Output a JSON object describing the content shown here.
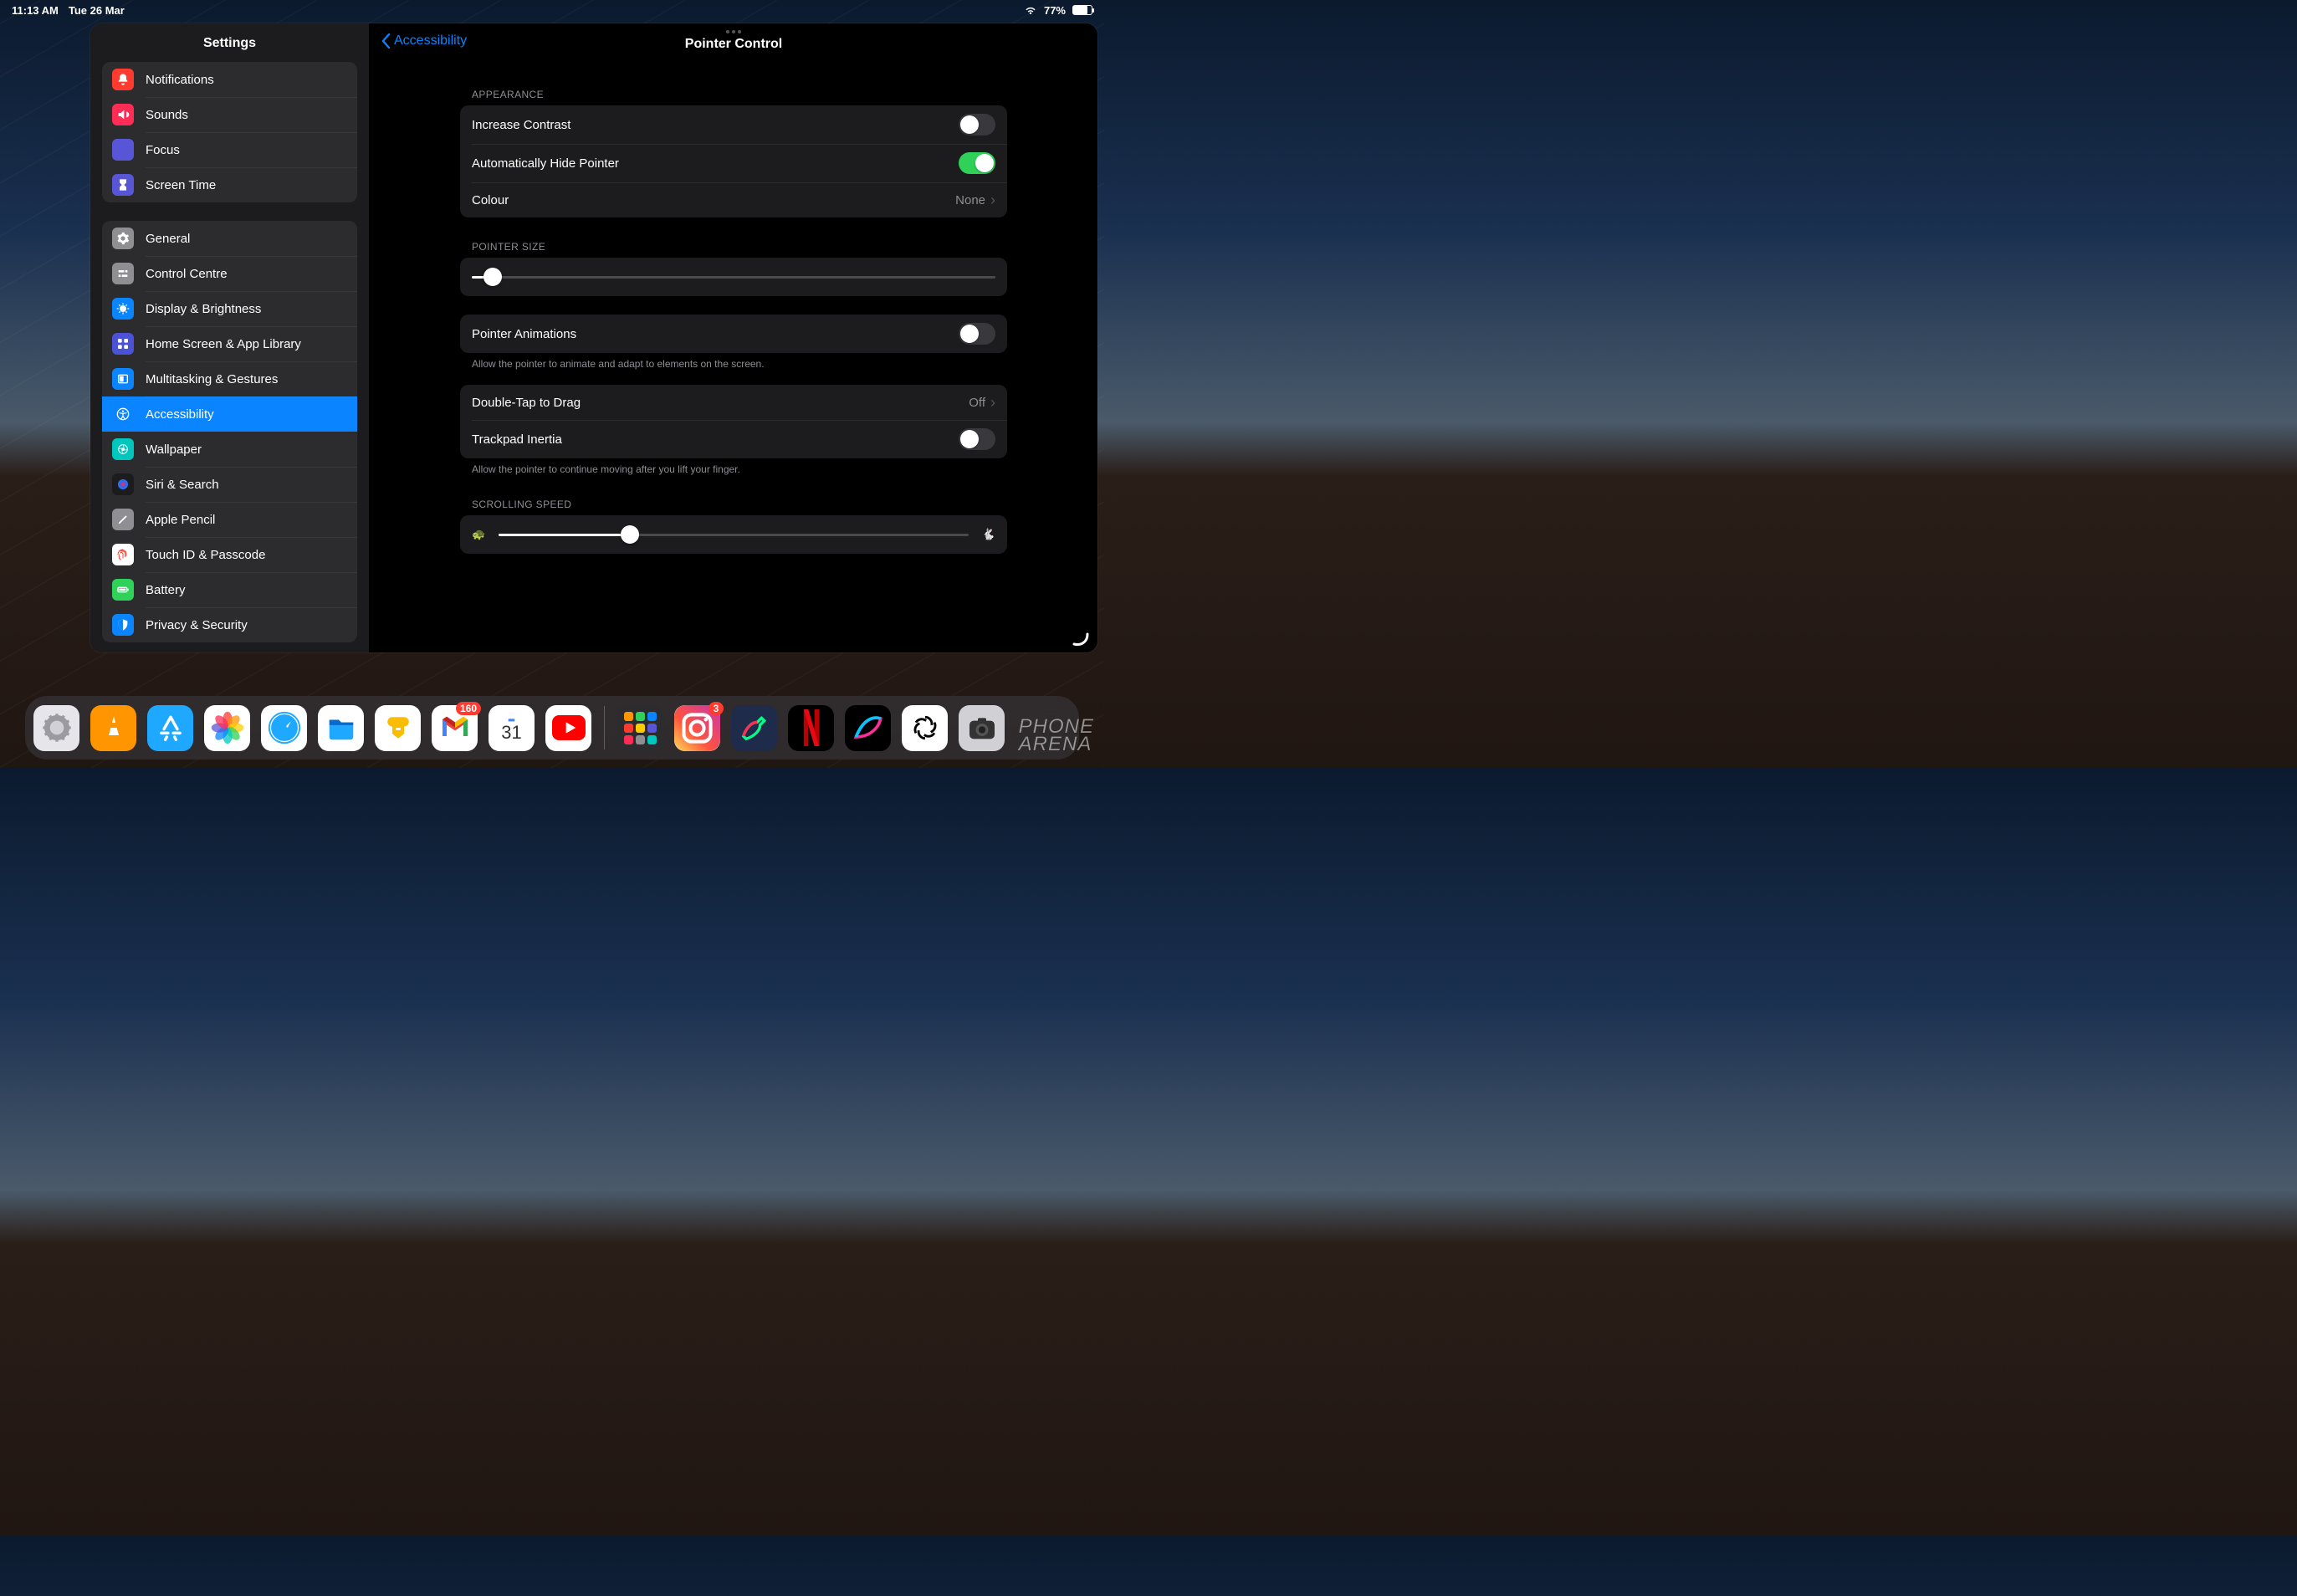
{
  "status": {
    "time": "11:13 AM",
    "date": "Tue 26 Mar",
    "battery_pct": "77%"
  },
  "sidebar": {
    "title": "Settings",
    "group1": [
      {
        "name": "notifications",
        "label": "Notifications",
        "color": "#ff3b30"
      },
      {
        "name": "sounds",
        "label": "Sounds",
        "color": "#ff2d55"
      },
      {
        "name": "focus",
        "label": "Focus",
        "color": "#5856d6"
      },
      {
        "name": "screen-time",
        "label": "Screen Time",
        "color": "#5856d6"
      }
    ],
    "group2": [
      {
        "name": "general",
        "label": "General",
        "color": "#8e8e93"
      },
      {
        "name": "control-centre",
        "label": "Control Centre",
        "color": "#8e8e93"
      },
      {
        "name": "display-brightness",
        "label": "Display & Brightness",
        "color": "#0a84ff"
      },
      {
        "name": "home-screen",
        "label": "Home Screen & App Library",
        "color": "#4b52d6"
      },
      {
        "name": "multitasking",
        "label": "Multitasking & Gestures",
        "color": "#0a84ff"
      },
      {
        "name": "accessibility",
        "label": "Accessibility",
        "color": "#0a84ff",
        "selected": true
      },
      {
        "name": "wallpaper",
        "label": "Wallpaper",
        "color": "#00c7be"
      },
      {
        "name": "siri-search",
        "label": "Siri & Search",
        "color": "#1c1c1e"
      },
      {
        "name": "apple-pencil",
        "label": "Apple Pencil",
        "color": "#8e8e93"
      },
      {
        "name": "touch-id",
        "label": "Touch ID & Passcode",
        "color": "#ffffff"
      },
      {
        "name": "battery",
        "label": "Battery",
        "color": "#30d158"
      },
      {
        "name": "privacy-security",
        "label": "Privacy & Security",
        "color": "#0a84ff"
      }
    ]
  },
  "detail": {
    "back_label": "Accessibility",
    "title": "Pointer Control",
    "appearance_header": "APPEARANCE",
    "increase_contrast_label": "Increase Contrast",
    "increase_contrast_on": false,
    "auto_hide_label": "Automatically Hide Pointer",
    "auto_hide_on": true,
    "colour_label": "Colour",
    "colour_value": "None",
    "pointer_size_header": "POINTER SIZE",
    "pointer_size_pct": 4,
    "pointer_animations_label": "Pointer Animations",
    "pointer_animations_on": false,
    "pointer_animations_footer": "Allow the pointer to animate and adapt to elements on the screen.",
    "double_tap_label": "Double-Tap to Drag",
    "double_tap_value": "Off",
    "trackpad_inertia_label": "Trackpad Inertia",
    "trackpad_inertia_on": false,
    "trackpad_inertia_footer": "Allow the pointer to continue moving after you lift your finger.",
    "scrolling_speed_header": "SCROLLING SPEED",
    "scrolling_speed_pct": 28
  },
  "dock": {
    "apps": [
      {
        "name": "settings",
        "bg": "#e5e5ea"
      },
      {
        "name": "vlc",
        "bg": "#ff9500"
      },
      {
        "name": "app-store",
        "bg": "#1fa8ff"
      },
      {
        "name": "photos",
        "bg": "#ffffff"
      },
      {
        "name": "safari",
        "bg": "#ffffff"
      },
      {
        "name": "files",
        "bg": "#ffffff"
      },
      {
        "name": "keep",
        "bg": "#ffffff"
      },
      {
        "name": "gmail",
        "bg": "#ffffff",
        "badge": "160"
      },
      {
        "name": "calendar",
        "bg": "#ffffff",
        "text": "31"
      },
      {
        "name": "youtube",
        "bg": "#ffffff"
      }
    ],
    "recent": [
      {
        "name": "folder",
        "bg": "#2c2c2e"
      },
      {
        "name": "instagram",
        "bg": "#ffffff",
        "badge": "3"
      },
      {
        "name": "freeform",
        "bg": "#1e2b4a"
      },
      {
        "name": "netflix",
        "bg": "#000000"
      },
      {
        "name": "procreate",
        "bg": "#000000"
      },
      {
        "name": "chatgpt",
        "bg": "#ffffff"
      },
      {
        "name": "camera",
        "bg": "#d0d0d5"
      }
    ]
  },
  "watermark": {
    "line1": "PHONE",
    "line2": "ARENA"
  }
}
